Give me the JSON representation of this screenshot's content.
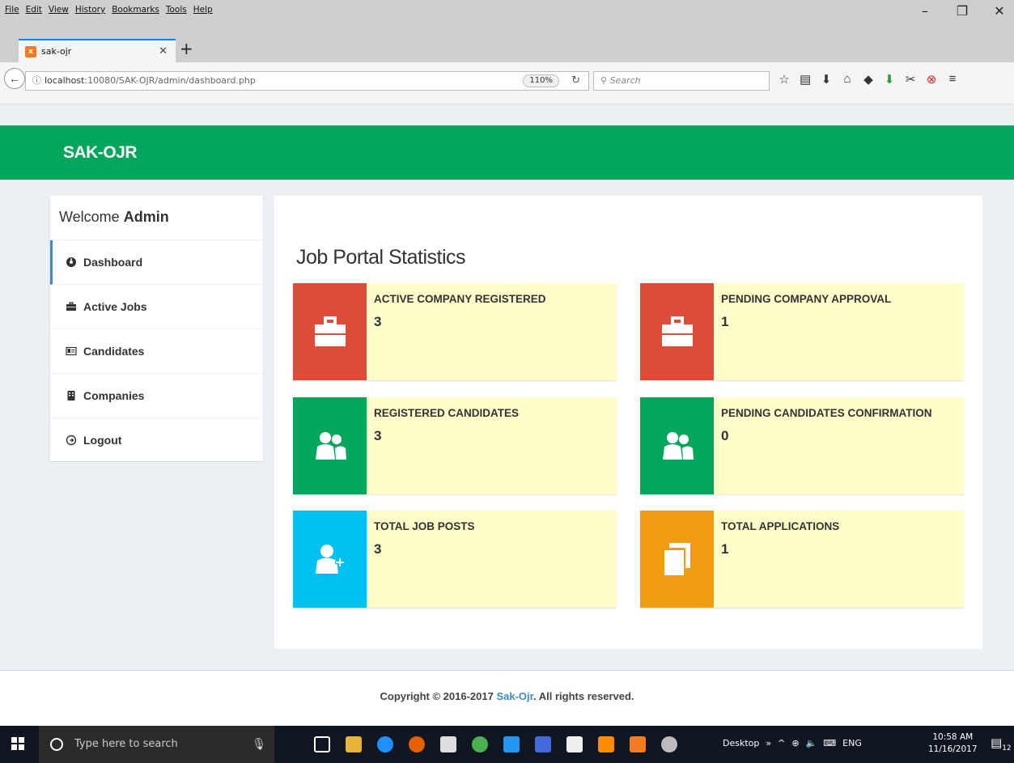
{
  "browser": {
    "menu": [
      "File",
      "Edit",
      "View",
      "History",
      "Bookmarks",
      "Tools",
      "Help"
    ],
    "tab_title": "sak-ojr",
    "url_host": "localhost",
    "url_path": ":10080/SAK-OJR/admin/dashboard.php",
    "zoom": "110%",
    "search_placeholder": "Search"
  },
  "site": {
    "brand": "SAK-OJR",
    "welcome_prefix": "Welcome",
    "welcome_user": "Admin",
    "nav": [
      {
        "label": "Dashboard",
        "icon": "dashboard-icon",
        "active": true
      },
      {
        "label": "Active Jobs",
        "icon": "briefcase-icon",
        "active": false
      },
      {
        "label": "Candidates",
        "icon": "id-card-icon",
        "active": false
      },
      {
        "label": "Companies",
        "icon": "building-icon",
        "active": false
      },
      {
        "label": "Logout",
        "icon": "logout-icon",
        "active": false
      }
    ],
    "heading": "Job Portal Statistics",
    "stats": [
      {
        "label": "ACTIVE COMPANY REGISTERED",
        "value": "3",
        "color": "#dd4b39",
        "icon": "briefcase-icon"
      },
      {
        "label": "PENDING COMPANY APPROVAL",
        "value": "1",
        "color": "#dd4b39",
        "icon": "briefcase-icon"
      },
      {
        "label": "REGISTERED CANDIDATES",
        "value": "3",
        "color": "#00a65a",
        "icon": "users-icon"
      },
      {
        "label": "PENDING CANDIDATES CONFIRMATION",
        "value": "0",
        "color": "#00a65a",
        "icon": "users-icon"
      },
      {
        "label": "TOTAL JOB POSTS",
        "value": "3",
        "color": "#00c0ef",
        "icon": "user-plus-icon"
      },
      {
        "label": "TOTAL APPLICATIONS",
        "value": "1",
        "color": "#f39c12",
        "icon": "copy-icon"
      }
    ],
    "footer_prefix": "Copyright © 2016-2017",
    "footer_link": "Sak-Ojr",
    "footer_suffix": ". All rights reserved."
  },
  "taskbar": {
    "search_placeholder": "Type here to search",
    "desktop_label": "Desktop",
    "language": "ENG",
    "time": "10:58 AM",
    "date": "11/16/2017",
    "notification_count": "12"
  }
}
